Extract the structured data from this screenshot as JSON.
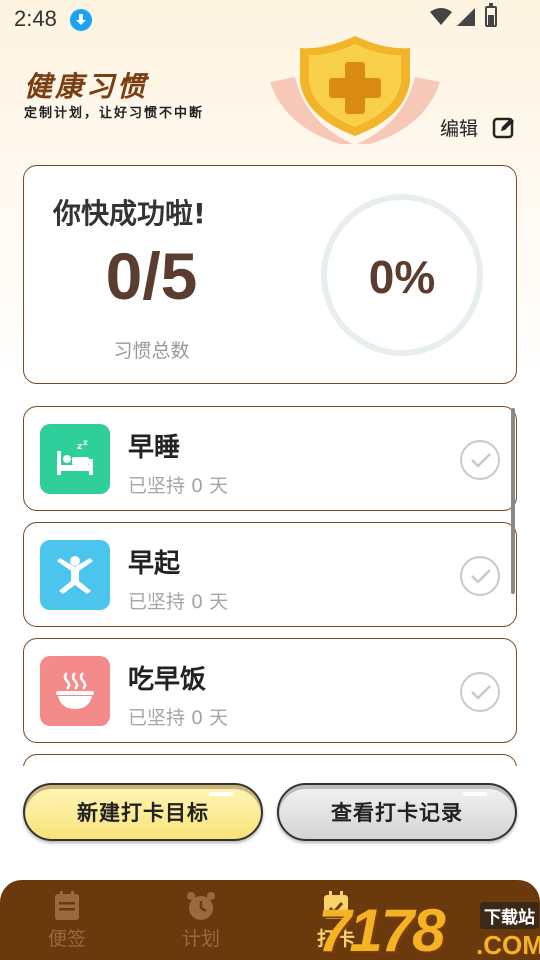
{
  "status_bar": {
    "time": "2:48"
  },
  "header": {
    "title": "健康习惯",
    "subtitle": "定制计划，让好习惯不中断",
    "edit_label": "编辑"
  },
  "summary": {
    "title": "你快成功啦!",
    "count": "0/5",
    "count_label": "习惯总数",
    "progress_text": "0%",
    "progress_fraction": 0
  },
  "habits": [
    {
      "name": "早睡",
      "days": "已坚持 0 天",
      "icon": "sleep-bed-icon",
      "color": "#2fcf9b"
    },
    {
      "name": "早起",
      "days": "已坚持 0 天",
      "icon": "stretch-person-icon",
      "color": "#4bc4ee"
    },
    {
      "name": "吃早饭",
      "days": "已坚持 0 天",
      "icon": "hot-bowl-icon",
      "color": "#f58a8a"
    }
  ],
  "buttons": {
    "new_goal": "新建打卡目标",
    "view_history": "查看打卡记录"
  },
  "tabs": [
    {
      "label": "便签",
      "icon": "notepad-icon"
    },
    {
      "label": "计划",
      "icon": "alarm-clock-icon"
    },
    {
      "label": "打卡",
      "icon": "calendar-check-icon",
      "active": true
    }
  ],
  "watermark": {
    "digits": "7178",
    "dotcom": ".COM",
    "cn": "下载站"
  },
  "colors": {
    "accent_brown": "#7a4b22",
    "title_brown": "#7a3e12",
    "tab_bar": "#6b3a0c",
    "active_tab": "#f7d36a",
    "new_button": "#f7e27a"
  }
}
